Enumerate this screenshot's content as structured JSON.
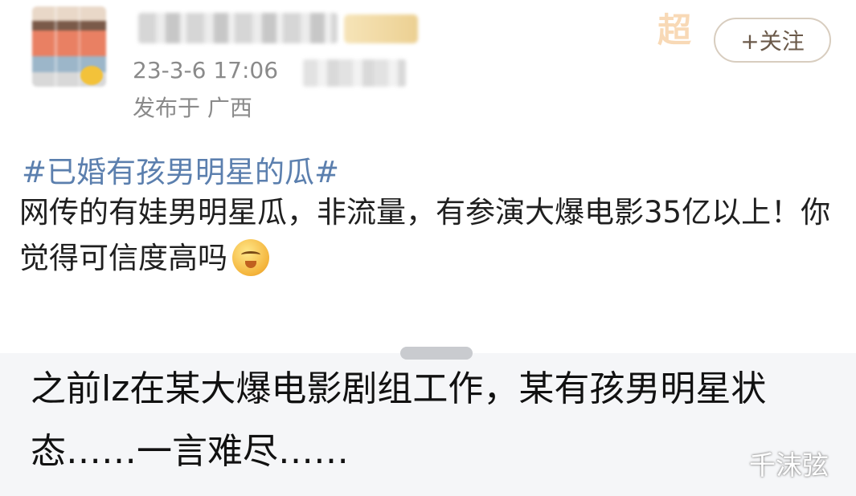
{
  "post": {
    "timestamp": "23-3-6 17:06",
    "location": "发布于 广西",
    "follow_label": "+关注",
    "brand_watermark": "超",
    "hashtag": "#已婚有孩男明星的瓜#",
    "body": "网传的有娃男明星瓜，非流量，有参演大爆电影35亿以上！你觉得可信度高吗"
  },
  "comment": {
    "text": "之前lz在某大爆电影剧组工作，某有孩男明星状态……一言难尽……"
  },
  "watermark": {
    "text": "千沫弦"
  },
  "colors": {
    "hashtag": "#5b7fae",
    "meta_text": "#8a8a8a",
    "comment_bg": "#f5f6f8"
  }
}
